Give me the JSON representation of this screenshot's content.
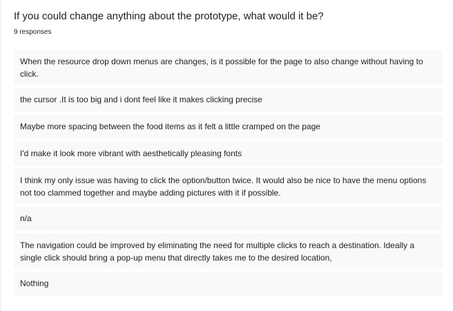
{
  "question": {
    "title": "If you could change anything about the prototype, what would it be?",
    "response_count": "9 responses"
  },
  "responses": [
    "When the resource drop down menus are changes, is it possible for the page to also change without having to click.",
    "the cursor .It is too big and i dont feel like it makes clicking precise",
    "Maybe more spacing between the food items as it felt a little cramped on the page",
    "I'd make it look more vibrant with aesthetically pleasing fonts",
    "I think my only issue was having to click the option/button twice. It would also be nice to have the menu options not too clammed together and maybe adding pictures with it if possible.",
    "n/a",
    "The navigation could be improved by eliminating the need for multiple clicks to reach a destination. Ideally a single click should bring a pop-up menu that directly takes me to the desired location,",
    "Nothing"
  ]
}
